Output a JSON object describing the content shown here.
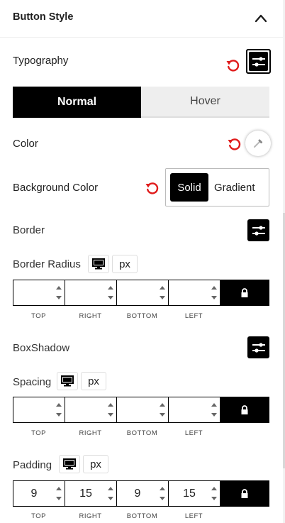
{
  "section": {
    "title": "Button Style"
  },
  "typography": {
    "label": "Typography"
  },
  "tabs": [
    {
      "label": "Normal",
      "active": true
    },
    {
      "label": "Hover",
      "active": false
    }
  ],
  "color": {
    "label": "Color"
  },
  "background_color": {
    "label": "Background Color",
    "options": [
      {
        "label": "Solid",
        "active": true
      },
      {
        "label": "Gradient",
        "active": false
      }
    ]
  },
  "border": {
    "label": "Border"
  },
  "border_radius": {
    "label": "Border Radius",
    "unit": "px",
    "values": {
      "top": "",
      "right": "",
      "bottom": "",
      "left": ""
    }
  },
  "boxshadow": {
    "label": "BoxShadow"
  },
  "spacing": {
    "label": "Spacing",
    "unit": "px",
    "values": {
      "top": "",
      "right": "",
      "bottom": "",
      "left": ""
    }
  },
  "padding": {
    "label": "Padding",
    "unit": "px",
    "values": {
      "top": "9",
      "right": "15",
      "bottom": "9",
      "left": "15"
    }
  },
  "dimension_labels": {
    "top": "TOP",
    "right": "RIGHT",
    "bottom": "BOTTOM",
    "left": "LEFT"
  },
  "colors": {
    "accent": "#000000",
    "reset": "#e01b1b",
    "tab_inactive_bg": "#eeeeee",
    "border": "#dddddd"
  },
  "icons": [
    "chevron-up-icon",
    "reset-icon",
    "sliders-icon",
    "eyedropper-icon",
    "desktop-icon",
    "lock-icon",
    "spinner-arrows-icon"
  ]
}
